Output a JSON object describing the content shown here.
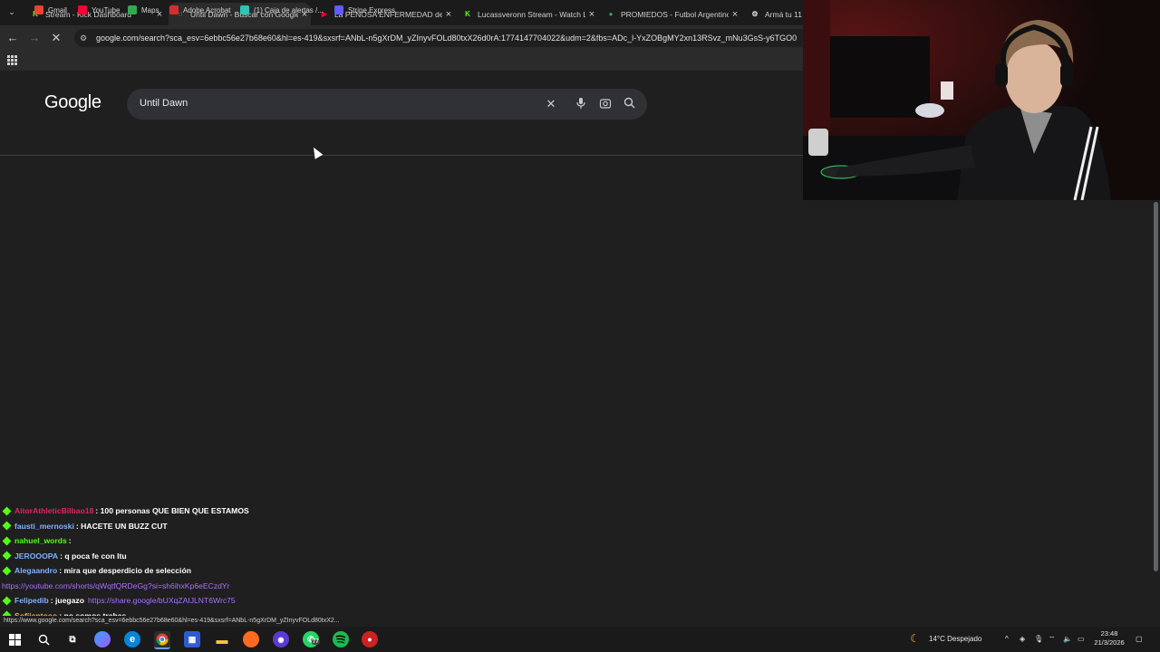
{
  "browser": {
    "tabs": [
      {
        "title": "Stream - Kick Dashboard",
        "active": false,
        "favicon": "kick-icon",
        "color": "#53fc18"
      },
      {
        "title": "Until Dawn - Buscar con Google",
        "active": true,
        "favicon": "loading-icon",
        "color": "#c8c8c8"
      },
      {
        "title": "La PENOSA ENFERMEDAD de l",
        "active": false,
        "favicon": "youtube-icon",
        "color": "#ff0033"
      },
      {
        "title": "Lucassveronn Stream - Watch L",
        "active": false,
        "favicon": "kick-icon",
        "color": "#53fc18"
      },
      {
        "title": "PROMIEDOS - Futbol Argentino",
        "active": false,
        "favicon": "promiedos-icon",
        "color": "#2fa84f"
      },
      {
        "title": "Armá tu 11",
        "active": false,
        "favicon": "gear-icon",
        "color": "#e0e0e0"
      }
    ],
    "url": "google.com/search?sca_esv=6ebbc56e27b68e60&hl=es-419&sxsrf=ANbL-n5gXrDM_yZInyvFOLd80txX26d0rA:1774147704022&udm=2&fbs=ADc_l-YxZOBgMY2xn13RSvz_mNu3GsS-y6TGO0",
    "bookmarks": [
      {
        "label": "Gmail",
        "icon": "gmail-icon",
        "color": "#ea4335"
      },
      {
        "label": "YouTube",
        "icon": "youtube-icon",
        "color": "#ff0033"
      },
      {
        "label": "Maps",
        "icon": "maps-icon",
        "color": "#34a853"
      },
      {
        "label": "Adobe Acrobat",
        "icon": "acrobat-icon",
        "color": "#d32f2f"
      },
      {
        "label": "(1) Caja de alertas /...",
        "icon": "alerts-icon",
        "color": "#2ec4b6"
      },
      {
        "label": "Stripe Express",
        "icon": "stripe-icon",
        "color": "#635bff"
      }
    ],
    "status_url": "https://www.google.com/search?sca_esv=6ebbc56e27b68e60&hl=es-419&sxsrf=ANbL-n5gXrDM_yZInyvFOLd80txX2..."
  },
  "google": {
    "logo": "Google",
    "query": "Until Dawn"
  },
  "chat": [
    {
      "user": "AitorAthleticBilbao18",
      "user_color": "#e0245e",
      "text": ": 100 personas QUE BIEN QUE ESTAMOS",
      "link": ""
    },
    {
      "user": "fausti_mernoski",
      "user_color": "#7fb2ff",
      "text": ": HACETE UN BUZZ CUT",
      "link": ""
    },
    {
      "user": "nahuel_words",
      "user_color": "#53fc18",
      "text": ":",
      "link": ""
    },
    {
      "user": "JEROOOPA",
      "user_color": "#7fb2ff",
      "text": ": q poca fe con ltu",
      "link": ""
    },
    {
      "user": "Alegaandro",
      "user_color": "#7fb2ff",
      "text": ": mira que desperdicio de selección",
      "link": ""
    },
    {
      "user": "",
      "user_color": "#a970ff",
      "text": "",
      "link": "https://youtube.com/shorts/qWqtfQRDeGg?si=sh6ihxKp6eECzdYr"
    },
    {
      "user": "Felipedib",
      "user_color": "#7fb2ff",
      "text": ": juegazo",
      "link": "https://share.google/bUXqZAIJLNT6Wrc75"
    },
    {
      "user": "Sofiiantooo",
      "user_color": "#ffb347",
      "text": ": no somos trabas",
      "link": ""
    }
  ],
  "taskbar": {
    "weather": "14°C  Despejado",
    "time": "23:48",
    "date": "21/3/2026",
    "whatsapp_badge": "77"
  }
}
